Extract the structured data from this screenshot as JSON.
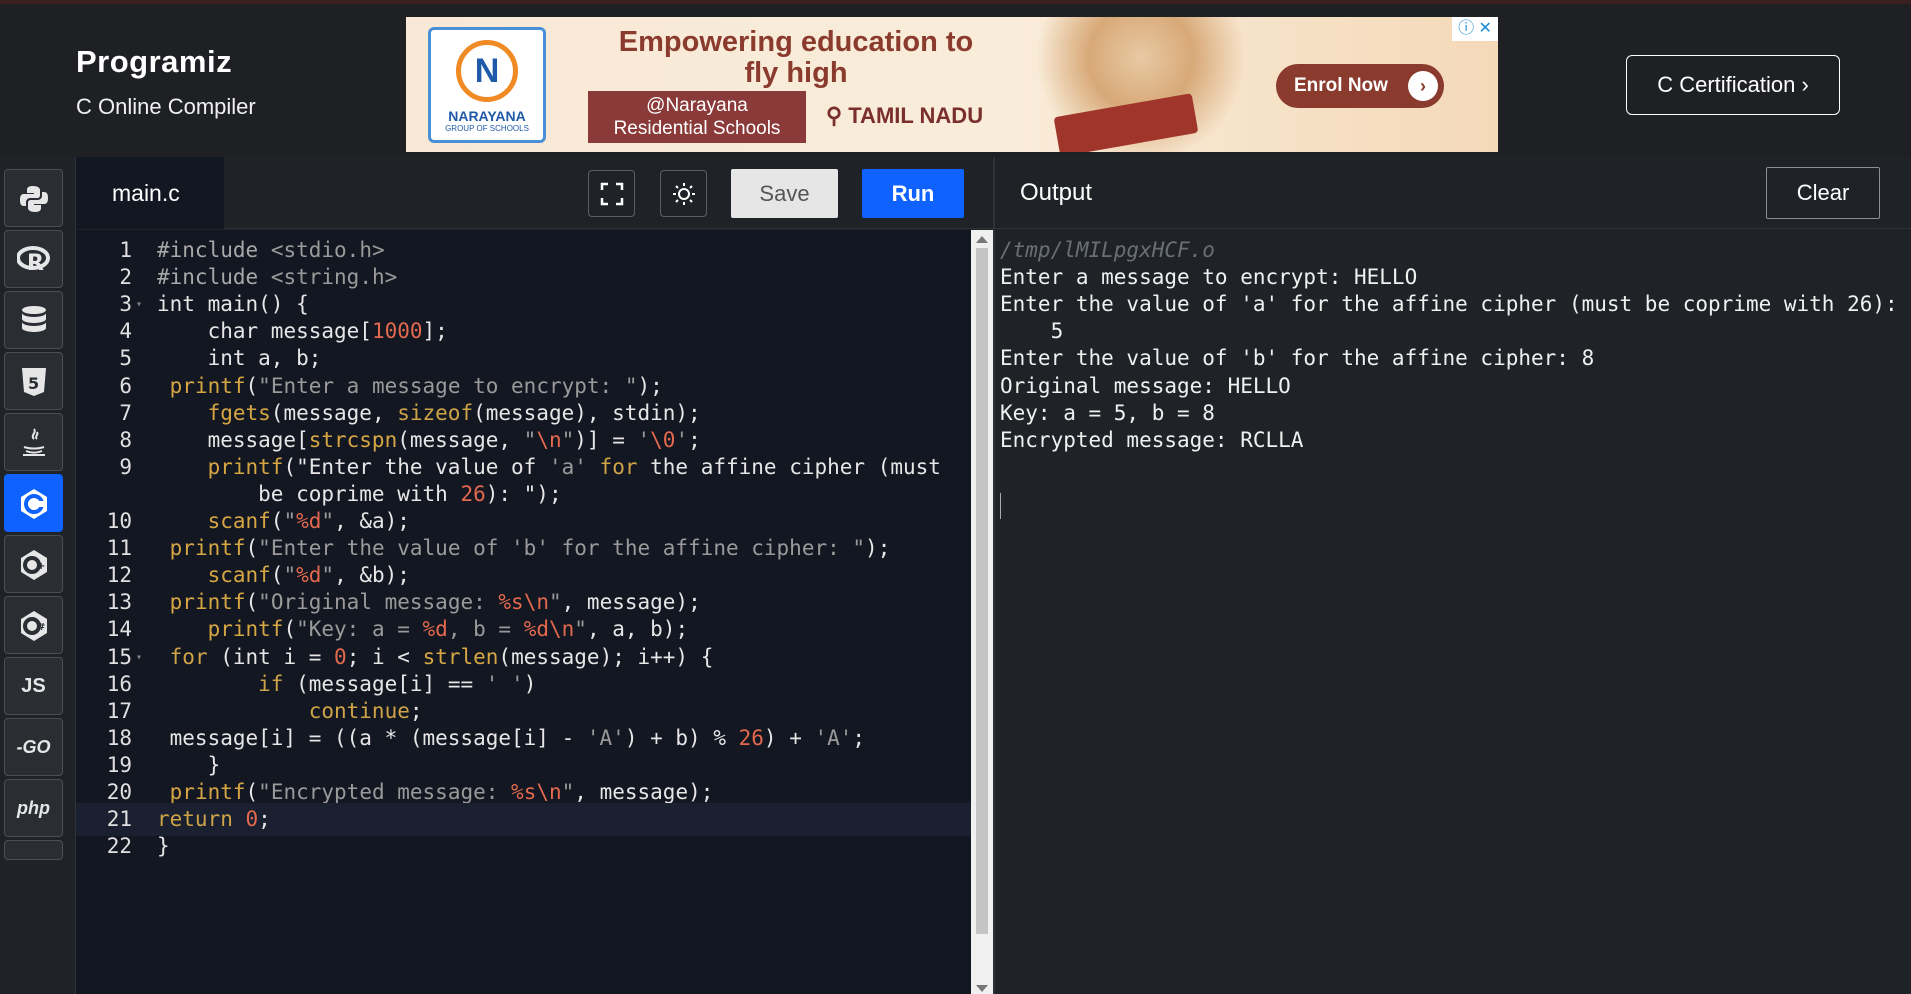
{
  "header": {
    "logo": "Programiz",
    "subtitle": "C Online Compiler",
    "cert_button": "C Certification ›"
  },
  "ad": {
    "brand": "NARAYANA",
    "brand_sub": "GROUP OF SCHOOLS",
    "headline": "Empowering education to fly high",
    "box_line1": "@Narayana",
    "box_line2": "Residential Schools",
    "location": "TAMIL NADU",
    "cta": "Enrol Now"
  },
  "sidebar": {
    "items": [
      {
        "name": "python",
        "label": ""
      },
      {
        "name": "r",
        "label": ""
      },
      {
        "name": "sql",
        "label": ""
      },
      {
        "name": "html",
        "label": ""
      },
      {
        "name": "java",
        "label": ""
      },
      {
        "name": "c",
        "label": "",
        "active": true
      },
      {
        "name": "cpp",
        "label": ""
      },
      {
        "name": "csharp",
        "label": ""
      },
      {
        "name": "js",
        "label": "JS"
      },
      {
        "name": "go",
        "label": "-GO"
      },
      {
        "name": "php",
        "label": "php"
      }
    ]
  },
  "editor": {
    "tab": "main.c",
    "save_label": "Save",
    "run_label": "Run"
  },
  "code_lines": [
    {
      "n": "1",
      "text": "#include <stdio.h>"
    },
    {
      "n": "2",
      "text": "#include <string.h>"
    },
    {
      "n": "3",
      "text": "int main() {"
    },
    {
      "n": "4",
      "text": "    char message[1000];"
    },
    {
      "n": "5",
      "text": "    int a, b;"
    },
    {
      "n": "6",
      "text": " printf(\"Enter a message to encrypt: \");"
    },
    {
      "n": "7",
      "text": "    fgets(message, sizeof(message), stdin);"
    },
    {
      "n": "8",
      "text": "    message[strcspn(message, \"\\n\")] = '\\0';"
    },
    {
      "n": "9",
      "text": "    printf(\"Enter the value of 'a' for the affine cipher (must"
    },
    {
      "n": "",
      "text": "        be coprime with 26): \");"
    },
    {
      "n": "10",
      "text": "    scanf(\"%d\", &a);"
    },
    {
      "n": "11",
      "text": " printf(\"Enter the value of 'b' for the affine cipher: \");"
    },
    {
      "n": "12",
      "text": "    scanf(\"%d\", &b);"
    },
    {
      "n": "13",
      "text": " printf(\"Original message: %s\\n\", message);"
    },
    {
      "n": "14",
      "text": "    printf(\"Key: a = %d, b = %d\\n\", a, b);"
    },
    {
      "n": "15",
      "text": " for (int i = 0; i < strlen(message); i++) {"
    },
    {
      "n": "16",
      "text": "        if (message[i] == ' ')"
    },
    {
      "n": "17",
      "text": "            continue;"
    },
    {
      "n": "18",
      "text": " message[i] = ((a * (message[i] - 'A') + b) % 26) + 'A';"
    },
    {
      "n": "19",
      "text": "    }"
    },
    {
      "n": "20",
      "text": " printf(\"Encrypted message: %s\\n\", message);"
    },
    {
      "n": "21",
      "text": "return 0;"
    },
    {
      "n": "22",
      "text": "}"
    }
  ],
  "output": {
    "title": "Output",
    "clear_label": "Clear",
    "lines": [
      "/tmp/lMILpgxHCF.o",
      "Enter a message to encrypt: HELLO",
      "Enter the value of 'a' for the affine cipher (must be coprime with 26):",
      "    5",
      "Enter the value of 'b' for the affine cipher: 8",
      "Original message: HELLO",
      "Key: a = 5, b = 8",
      "Encrypted message: RCLLA"
    ]
  }
}
